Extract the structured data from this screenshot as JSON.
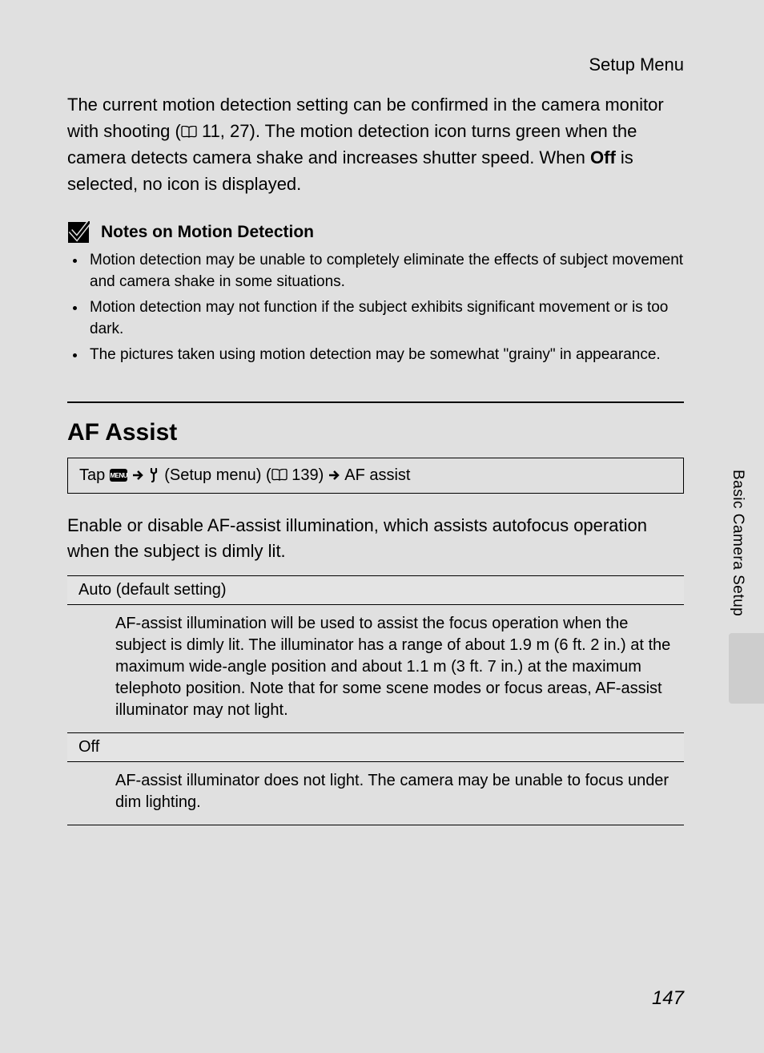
{
  "header": {
    "breadcrumb": "Setup Menu"
  },
  "intro": {
    "t1": "The current motion detection setting can be confirmed in the camera monitor with shooting (",
    "ref1": " 11, 27). The motion detection icon turns green when the camera detects camera shake and increases shutter speed. When ",
    "off": "Off",
    "t2": " is selected, no icon is displayed."
  },
  "notes": {
    "title": "Notes on Motion Detection",
    "items": [
      "Motion detection may be unable to completely eliminate the effects of subject movement and camera shake in some situations.",
      "Motion detection may not function if the subject exhibits significant movement or is too dark.",
      "The pictures taken using motion detection may be somewhat \"grainy\" in appearance."
    ]
  },
  "af": {
    "title": "AF Assist",
    "nav": {
      "tap": "Tap",
      "menu_badge": "MENU",
      "setup": "(Setup menu) (",
      "ref": " 139)",
      "tail": "AF assist"
    },
    "desc": "Enable or disable AF-assist illumination, which assists autofocus operation when the subject is dimly lit.",
    "options": [
      {
        "label": "Auto (default setting)",
        "body": "AF-assist illumination will be used to assist the focus operation when the subject is dimly lit. The illuminator has a range of about 1.9 m (6 ft. 2 in.) at the maximum wide-angle position and about 1.1 m (3 ft. 7 in.) at the maximum telephoto position. Note that for some scene modes or focus areas, AF-assist illuminator may not light."
      },
      {
        "label": "Off",
        "body": "AF-assist illuminator does not light. The camera may be unable to focus under dim lighting."
      }
    ]
  },
  "side": {
    "tab": "Basic Camera Setup"
  },
  "page": "147"
}
